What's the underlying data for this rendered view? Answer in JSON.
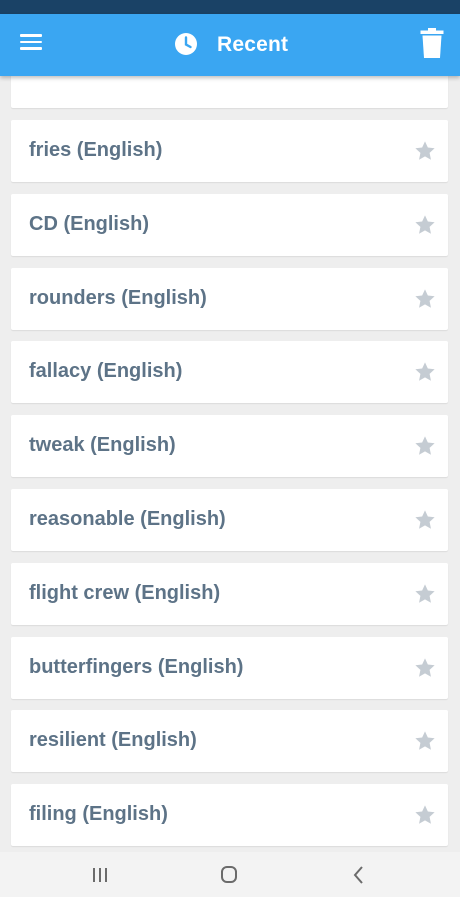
{
  "header": {
    "title": "Recent",
    "menu_icon": "hamburger-menu-icon",
    "history_icon": "clock-icon",
    "delete_icon": "trash-icon"
  },
  "list": {
    "items": [
      {
        "label": "fries (English)",
        "starred": false
      },
      {
        "label": "CD (English)",
        "starred": false
      },
      {
        "label": "rounders (English)",
        "starred": false
      },
      {
        "label": "fallacy (English)",
        "starred": false
      },
      {
        "label": "tweak (English)",
        "starred": false
      },
      {
        "label": "reasonable (English)",
        "starred": false
      },
      {
        "label": "flight crew (English)",
        "starred": false
      },
      {
        "label": "butterfingers (English)",
        "starred": false
      },
      {
        "label": "resilient (English)",
        "starred": false
      },
      {
        "label": "filing (English)",
        "starred": false
      }
    ]
  },
  "navigation": {
    "recents_icon": "recent-apps-icon",
    "home_icon": "home-icon",
    "back_icon": "back-icon"
  },
  "colors": {
    "app_bar": "#3aa6f2",
    "status_bar": "#1a4266",
    "item_text": "#5d7387",
    "star": "#c5ccd3",
    "background": "#eeeeee"
  }
}
